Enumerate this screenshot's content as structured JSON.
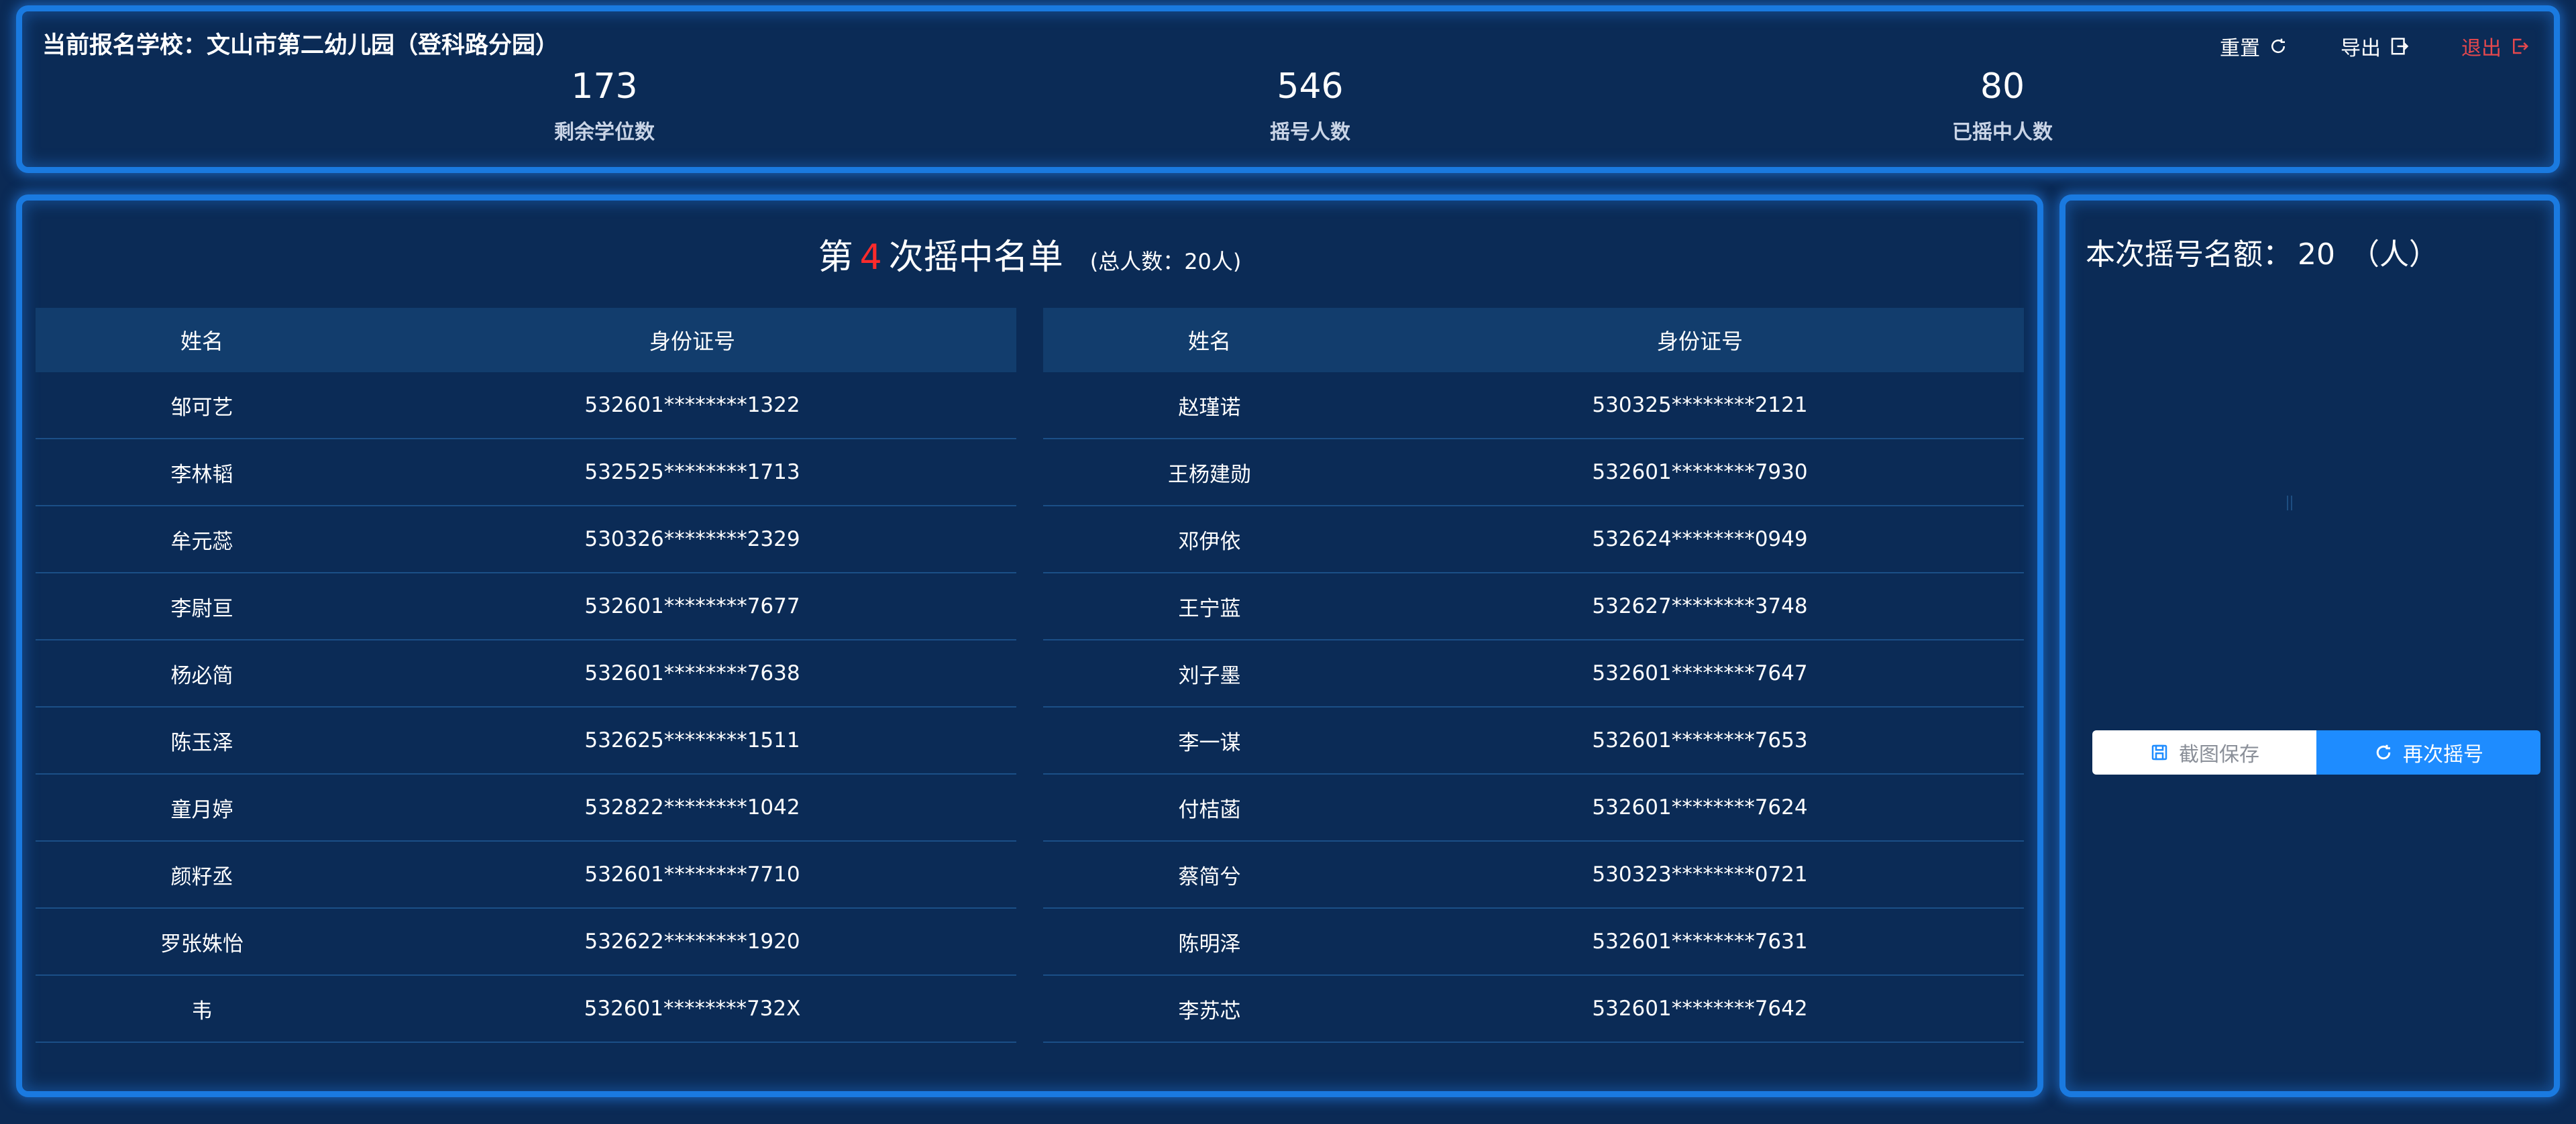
{
  "header": {
    "school_label": "当前报名学校：文山市第二幼儿园（登科路分园）",
    "actions": {
      "reset": "重置",
      "export": "导出",
      "logout": "退出"
    },
    "stats": [
      {
        "value": "173",
        "label": "剩余学位数"
      },
      {
        "value": "546",
        "label": "摇号人数"
      },
      {
        "value": "80",
        "label": "已摇中人数"
      }
    ]
  },
  "list": {
    "title_prefix": "第",
    "round": "4",
    "title_suffix": "次摇中名单",
    "total": "(总人数：20人)",
    "columns": {
      "name": "姓名",
      "id": "身份证号"
    },
    "left_rows": [
      {
        "name": "邹可艺",
        "id": "532601********1322"
      },
      {
        "name": "李林韬",
        "id": "532525********1713"
      },
      {
        "name": "牟元蕊",
        "id": "530326********2329"
      },
      {
        "name": "李尉亘",
        "id": "532601********7677"
      },
      {
        "name": "杨必简",
        "id": "532601********7638"
      },
      {
        "name": "陈玉泽",
        "id": "532625********1511"
      },
      {
        "name": "童月婷",
        "id": "532822********1042"
      },
      {
        "name": "颜籽丞",
        "id": "532601********7710"
      },
      {
        "name": "罗张姝怡",
        "id": "532622********1920"
      },
      {
        "name": "韦",
        "id": "532601********732X"
      }
    ],
    "right_rows": [
      {
        "name": "赵瑾诺",
        "id": "530325********2121"
      },
      {
        "name": "王杨建勋",
        "id": "532601********7930"
      },
      {
        "name": "邓伊依",
        "id": "532624********0949"
      },
      {
        "name": "王宁蓝",
        "id": "532627********3748"
      },
      {
        "name": "刘子墨",
        "id": "532601********7647"
      },
      {
        "name": "李一谋",
        "id": "532601********7653"
      },
      {
        "name": "付桔菡",
        "id": "532601********7624"
      },
      {
        "name": "蔡简兮",
        "id": "530323********0721"
      },
      {
        "name": "陈明泽",
        "id": "532601********7631"
      },
      {
        "name": "李苏芯",
        "id": "532601********7642"
      }
    ]
  },
  "side": {
    "quota_label": "本次摇号名额：",
    "quota_value": "20",
    "quota_unit": "（人）",
    "save_button": "截图保存",
    "again_button": "再次摇号"
  },
  "colors": {
    "background": "#0b2a55",
    "border_glow": "#1a7ae0",
    "accent_red": "#ff2b2b",
    "logout_red": "#e5484d",
    "primary_button": "#1e8cff"
  }
}
